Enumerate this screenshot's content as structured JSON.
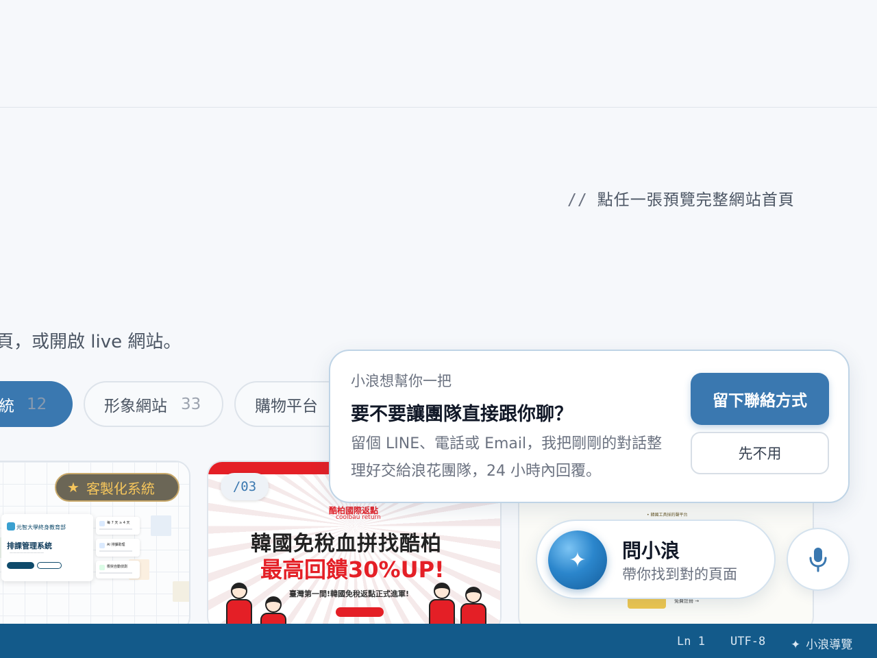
{
  "hint": {
    "slashes": "//",
    "text": "點任一張預覽完整網站首頁"
  },
  "intro": {
    "text": "頁，或開啟 live 網站。"
  },
  "filters": [
    {
      "label": "統",
      "count": "12",
      "active": true
    },
    {
      "label": "形象網站",
      "count": "33",
      "active": false
    },
    {
      "label": "購物平台",
      "count": "",
      "active": false
    }
  ],
  "cards": {
    "card1": {
      "badge_star": "★",
      "badge": "客製化系統",
      "mini_brand": "元智大學終身教育部",
      "mini_system": "排課管理系統",
      "mini_list": [
        "每 7 天 ≥ 4 天",
        "AI 排課助理",
        "衝突自動偵測"
      ]
    },
    "card2": {
      "number": "/03",
      "brand": "酷柏國際返點",
      "brand_sub": "coolbau return",
      "headline1": "韓國免稅血拼找酷柏",
      "headline2": "最高回饋30%UP!",
      "tagline": "臺灣第一間!韓國免稅返點正式進軍!"
    },
    "card3": {
      "mini_top": "• 韓國工具採的聲平台",
      "mini_link": "免費註冊 →"
    }
  },
  "prompt": {
    "eyebrow": "小浪想幫你一把",
    "title": "要不要讓團隊直接跟你聊？",
    "body": "留個 LINE、電話或 Email，我把剛剛的對話整理好交給浪花團隊，24 小時內回覆。",
    "primary_label": "留下聯絡方式",
    "secondary_label": "先不用"
  },
  "assistant": {
    "spark": "✦",
    "name": "問小浪",
    "desc": "帶你找到對的頁面"
  },
  "statusbar": {
    "ln": "Ln 1",
    "encoding": "UTF-8",
    "guide_spark": "✦",
    "guide": "小浪導覽"
  },
  "colors": {
    "accent": "#3a78b0",
    "status_bar": "#135a8a",
    "card_red": "#e41f26",
    "badge_gold": "#f6c65c"
  },
  "icons": [
    "star-icon",
    "sparkle-icon",
    "microphone-icon"
  ]
}
